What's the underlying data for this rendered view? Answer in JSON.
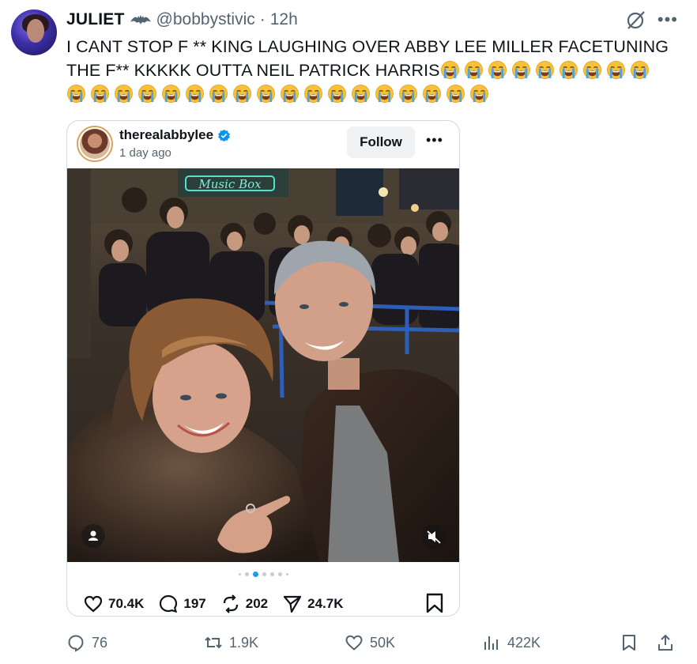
{
  "author": {
    "display_name": "JULIET",
    "handle": "@bobbystivic",
    "separator": "·",
    "time": "12h",
    "badge_icon": "bat-icon"
  },
  "tweet": {
    "line1": "I CANT STOP F ** KING LAUGHING OVER ABBY LEE MILLER FACETUNING",
    "line2": "THE F** KKKKK OUTTA NEIL PATRICK HARRIS",
    "emoji_name": "loudly-crying-face",
    "emoji_count_line2": 9,
    "emoji_count_line3": 18
  },
  "embed": {
    "username": "therealabbylee",
    "time": "1 day ago",
    "follow_label": "Follow",
    "more_label": "•••",
    "neon_sign": "Music Box",
    "carousel_count": 7,
    "carousel_active": 2,
    "likes": "70.4K",
    "comments": "197",
    "reposts": "202",
    "shares": "24.7K"
  },
  "actions": {
    "replies": "76",
    "retweets": "1.9K",
    "likes": "50K",
    "views": "422K"
  },
  "colors": {
    "accent": "#1d9bf0",
    "secondary_text": "#536471",
    "border": "#cfd9de"
  }
}
